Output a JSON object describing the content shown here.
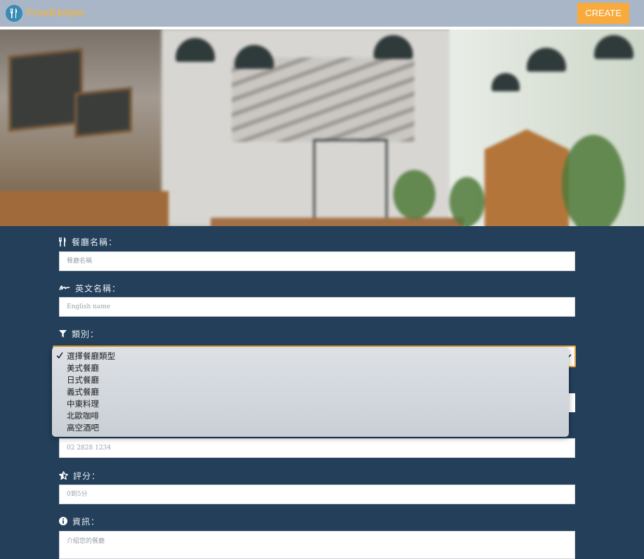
{
  "navbar": {
    "brand": "FoodHelper",
    "create_label": "CREATE",
    "colors": {
      "bar": "#a8b6c7",
      "brand_text": "#f6b33b",
      "button": "#f8aa3c"
    }
  },
  "hero": {
    "icon": "cafe-interior-photo"
  },
  "form": {
    "name": {
      "label": "餐廳名稱：",
      "placeholder": "餐廳名稱",
      "icon": "utensils-icon"
    },
    "name_en": {
      "label": "英文名稱：",
      "placeholder": "English name",
      "icon": "signature-icon"
    },
    "category": {
      "label": "類別：",
      "icon": "filter-icon",
      "selected": "選擇餐廳類型",
      "options": [
        "選擇餐廳類型",
        "美式餐廳",
        "日式餐廳",
        "義式餐廳",
        "中東料理",
        "北歐咖啡",
        "高空酒吧"
      ]
    },
    "phone": {
      "placeholder": "02 2828 1234"
    },
    "rating": {
      "label": "評分：",
      "placeholder": "0到5分",
      "icon": "star-half-icon"
    },
    "info": {
      "label": "資訊：",
      "placeholder": "介紹您的餐廳",
      "icon": "info-circle-icon"
    }
  },
  "colors": {
    "background": "#233f5a",
    "focus_border": "#e9a23b"
  }
}
